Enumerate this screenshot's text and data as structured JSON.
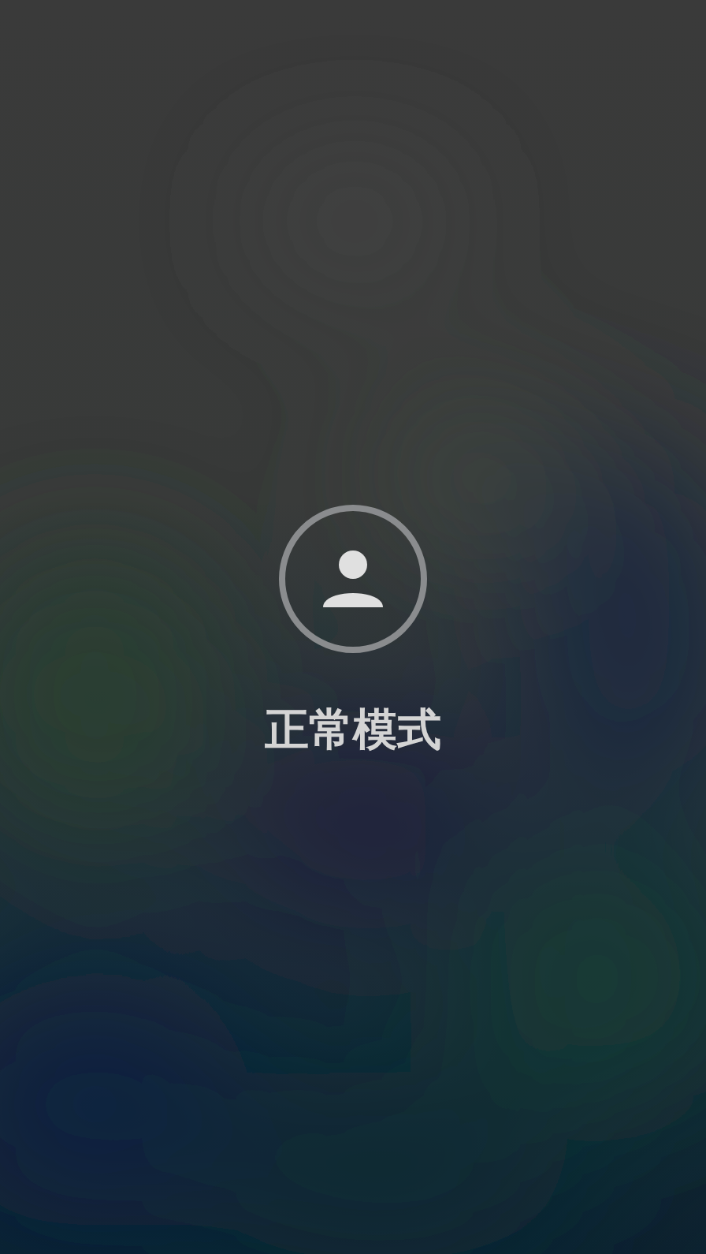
{
  "profile": {
    "label": "正常模式"
  }
}
